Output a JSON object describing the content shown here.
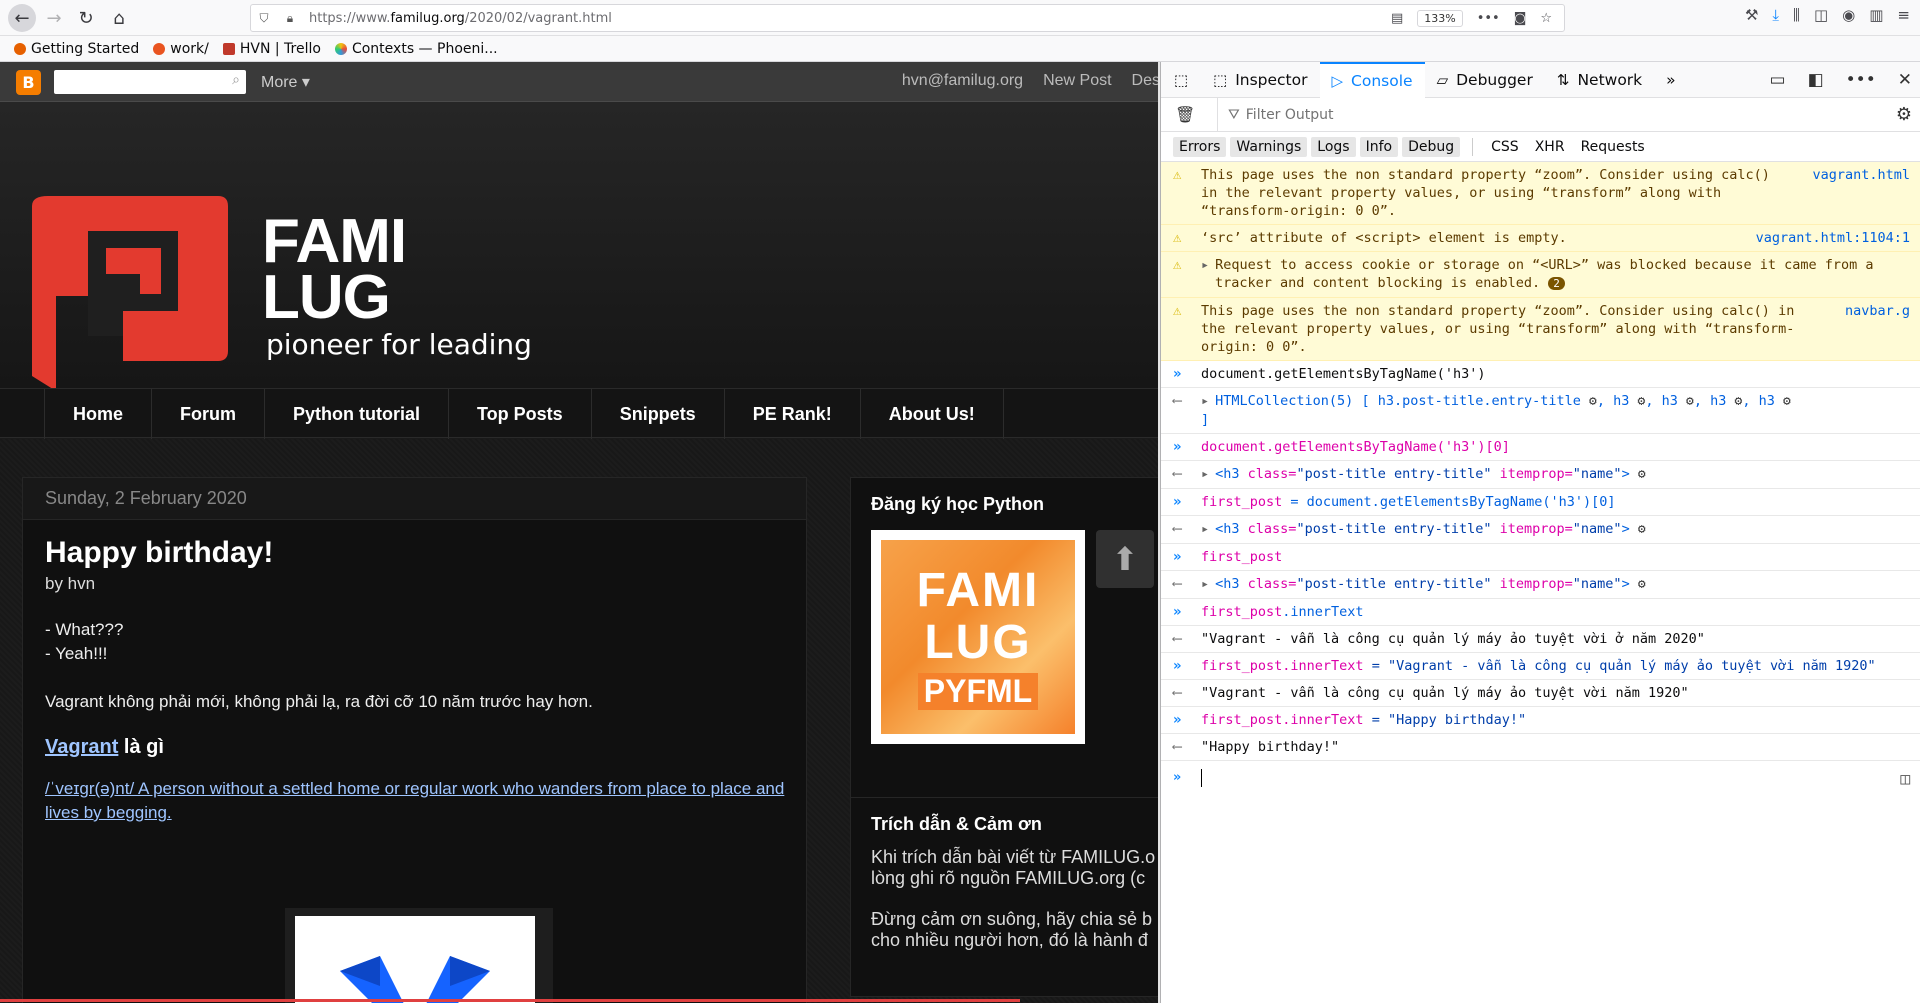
{
  "browser": {
    "url_host": "https://www.",
    "url_domain": "familug.org",
    "url_path": "/2020/02/vagrant.html",
    "zoom": "133%",
    "bookmarks": [
      "Getting Started",
      "work/",
      "HVN | Trello",
      "Contexts — Phoeni..."
    ]
  },
  "blog": {
    "more": "More",
    "email": "hvn@familug.org",
    "new_post": "New Post",
    "design": "Des",
    "brand_line1": "FAMI",
    "brand_line2": "LUG",
    "tagline": "pioneer for leading",
    "menu": [
      "Home",
      "Forum",
      "Python tutorial",
      "Top Posts",
      "Snippets",
      "PE Rank!",
      "About Us!"
    ],
    "post": {
      "date": "Sunday, 2 February 2020",
      "title": "Happy birthday!",
      "by": "by hvn",
      "line1": "- What???",
      "line2": "- Yeah!!!",
      "para": "Vagrant không phải mới, không phải lạ, ra đời cỡ 10 năm trước hay hơn.",
      "heading_link": "Vagrant",
      "heading_rest": " là gì",
      "definition": "/ˈveɪɡr(ə)nt/ A person without a settled home or regular work who wanders from place to place and lives by begging."
    },
    "sidebar1_title": "Đăng ký học Python",
    "pyfml_big1": "FAMI",
    "pyfml_big2": "LUG",
    "pyfml_small": "PYFML",
    "sidebar2_title": "Trích dẫn & Cảm ơn",
    "sidebar2_l1": "Khi trích dẫn bài viết từ FAMILUG.o",
    "sidebar2_l2": "lòng ghi rõ nguồn FAMILUG.org (c",
    "sidebar2_l3": "Đừng cảm ơn suông, hãy chia sẻ b",
    "sidebar2_l4": "cho nhiều người hơn, đó là hành đ"
  },
  "devtools": {
    "tabs": [
      "Inspector",
      "Console",
      "Debugger",
      "Network"
    ],
    "filter_placeholder": "Filter Output",
    "categories": [
      "Errors",
      "Warnings",
      "Logs",
      "Info",
      "Debug"
    ],
    "extra_cats": [
      "CSS",
      "XHR",
      "Requests"
    ],
    "warn1": "This page uses the non standard property “zoom”. Consider using calc() in the relevant property values, or using “transform” along with “transform-origin: 0 0”.",
    "warn1_src": "vagrant.html",
    "warn2": "‘src’ attribute of <script> element is empty.",
    "warn2_src": "vagrant.html:1104:1",
    "warn3": "Request to access cookie or storage on “<URL>” was blocked because it came from a tracker and content blocking is enabled.",
    "warn3_count": "2",
    "warn4": "This page uses the non standard property “zoom”. Consider using calc() in the relevant property values, or using “transform” along with “transform-origin: 0 0”.",
    "warn4_src": "navbar.g",
    "in1": "document.getElementsByTagName('h3')",
    "out1_a": "HTMLCollection(5)",
    "out1_b": "[ h3.post-title.entry-title",
    "out1_c": ", h3",
    "out1_d": "]",
    "in2": "document.getElementsByTagName('h3')[0]",
    "h3_tag_open": "<h3 ",
    "h3_class_attr": "class=",
    "h3_class_val": "\"post-title entry-title\"",
    "h3_itemprop_attr": " itemprop=",
    "h3_itemprop_val": "\"name\"",
    "h3_tag_close": ">",
    "in3_var": "first_post",
    "in3_rest": " = document.getElementsByTagName('h3')[0]",
    "in4": "first_post",
    "in5_var": "first_post",
    "in5_prop": ".innerText",
    "out5": "\"Vagrant - vẫn là công cụ quản lý máy ảo tuyệt vời ở năm 2020\"",
    "in6_lhs": "first_post.innerText",
    "in6_rhs": " = \"Vagrant - vẫn là công cụ quản lý máy ảo tuyệt vời năm 1920\"",
    "out6": "\"Vagrant - vẫn là công cụ quản lý máy ảo tuyệt vời năm 1920\"",
    "in7_lhs": "first_post.innerText",
    "in7_rhs": " = \"Happy birthday!\"",
    "out7": "\"Happy birthday!\""
  }
}
